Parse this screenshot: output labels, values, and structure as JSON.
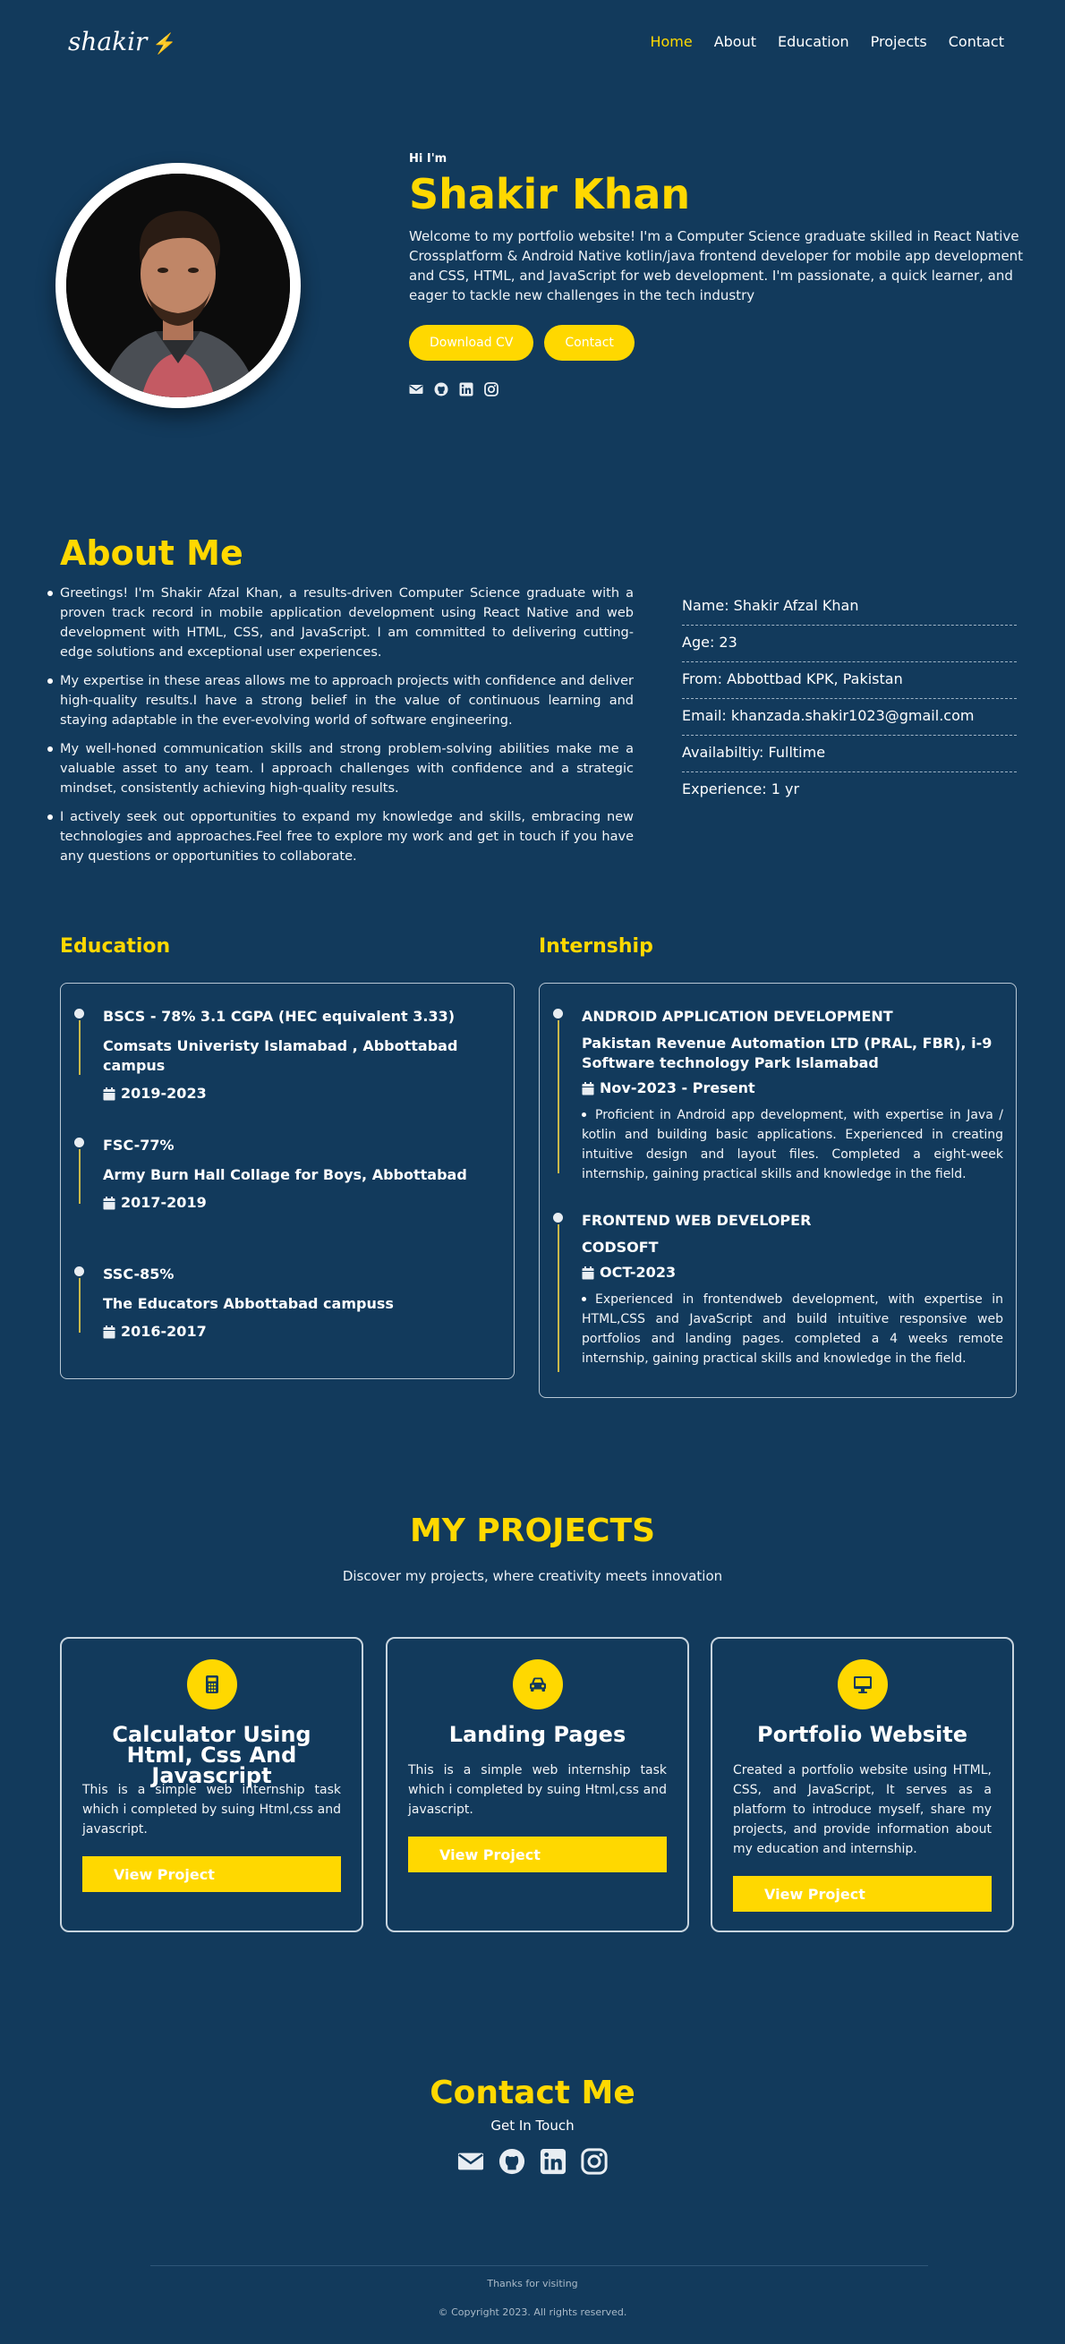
{
  "nav": {
    "logo": "shakir",
    "items": [
      {
        "label": "Home",
        "active": true
      },
      {
        "label": "About",
        "active": false
      },
      {
        "label": "Education",
        "active": false
      },
      {
        "label": "Projects",
        "active": false
      },
      {
        "label": "Contact",
        "active": false
      }
    ]
  },
  "hero": {
    "greeting": "Hi I'm",
    "name": "Shakir Khan",
    "description": "Welcome to my portfolio website! I'm a Computer Science graduate skilled in React Native Crossplatform & Android Native kotlin/java frontend developer for mobile app development and CSS, HTML, and JavaScript for web development. I'm passionate, a quick learner, and eager to tackle new challenges in the tech industry",
    "download_cv": "Download CV",
    "contact": "Contact",
    "socials": [
      "envelope-icon",
      "github-icon",
      "linkedin-icon",
      "instagram-icon"
    ]
  },
  "about": {
    "title": "About Me",
    "paragraphs": [
      "Greetings! I'm Shakir Afzal Khan, a results-driven Computer Science graduate with a proven track record in mobile application development using React Native and web development with HTML, CSS, and JavaScript. I am committed to delivering cutting-edge solutions and exceptional user experiences.",
      "My expertise in these areas allows me to approach projects with confidence and deliver high-quality results.I have a strong belief in the value of continuous learning and staying adaptable in the ever-evolving world of software engineering.",
      "My well-honed communication skills and strong problem-solving abilities make me a valuable asset to any team. I approach challenges with confidence and a strategic mindset, consistently achieving high-quality results.",
      "I actively seek out opportunities to expand my knowledge and skills, embracing new technologies and approaches.Feel free to explore my work and get in touch if you have any questions or opportunities to collaborate."
    ],
    "info": [
      "Name: Shakir Afzal Khan",
      "Age: 23",
      "From: Abbottbad KPK, Pakistan",
      "Email: khanzada.shakir1023@gmail.com",
      "Availabiltiy: Fulltime",
      "Experience: 1 yr"
    ]
  },
  "education": {
    "title": "Education",
    "items": [
      {
        "degree": "BSCS - 78% 3.1 CGPA (HEC equivalent 3.33)",
        "school": "Comsats Univeristy Islamabad , Abbottabad campus",
        "years": "2019-2023"
      },
      {
        "degree": "FSC-77%",
        "school": "Army Burn Hall Collage for Boys, Abbottabad",
        "years": "2017-2019"
      },
      {
        "degree": "SSC-85%",
        "school": "The Educators Abbottabad campuss",
        "years": "2016-2017"
      }
    ]
  },
  "internship": {
    "title": "Internship",
    "items": [
      {
        "role": "ANDROID APPLICATION DEVELOPMENT",
        "company": "Pakistan Revenue Automation LTD (PRAL, FBR), i-9 Software technology Park Islamabad",
        "period": "Nov-2023 - Present",
        "description": "Proficient in Android app development, with expertise in Java / kotlin and building basic applications. Experienced in creating intuitive design and layout files. Completed a eight-week internship, gaining practical skills and knowledge in the field."
      },
      {
        "role": "FRONTEND WEB DEVELOPER",
        "company": "CODSOFT",
        "period": "OCT-2023",
        "description": "Experienced in frontendweb development, with expertise in HTML,CSS and JavaScript and build intuitive responsive web portfolios and landing pages. completed a 4 weeks remote internship, gaining practical skills and knowledge in the field."
      }
    ]
  },
  "projects": {
    "title": "MY PROJECTS",
    "subtitle": "Discover my projects, where creativity meets innovation",
    "items": [
      {
        "icon": "calculator-icon",
        "title": "Calculator Using Html, Css And Javascript",
        "description": "This is a simple web internship task which i completed by suing Html,css and javascript.",
        "button": "View Project"
      },
      {
        "icon": "car-icon",
        "title": "Landing Pages",
        "description": "This is a simple web internship task which i completed by suing Html,css and javascript.",
        "button": "View Project"
      },
      {
        "icon": "desktop-icon",
        "title": "Portfolio Website",
        "description": "Created a portfolio website using HTML, CSS, and JavaScript, It serves as a platform to introduce myself, share my projects, and provide information about my education and internship.",
        "button": "View Project"
      }
    ]
  },
  "contact": {
    "title": "Contact Me",
    "subtitle": "Get In Touch",
    "socials": [
      "envelope-icon",
      "github-icon",
      "linkedin-icon",
      "instagram-icon"
    ]
  },
  "footer": {
    "thanks": "Thanks for visiting",
    "copyright": "© Copyright 2023. All rights reserved."
  },
  "colors": {
    "background": "#123a5c",
    "accent": "#ffd800",
    "text": "#ffffff"
  }
}
